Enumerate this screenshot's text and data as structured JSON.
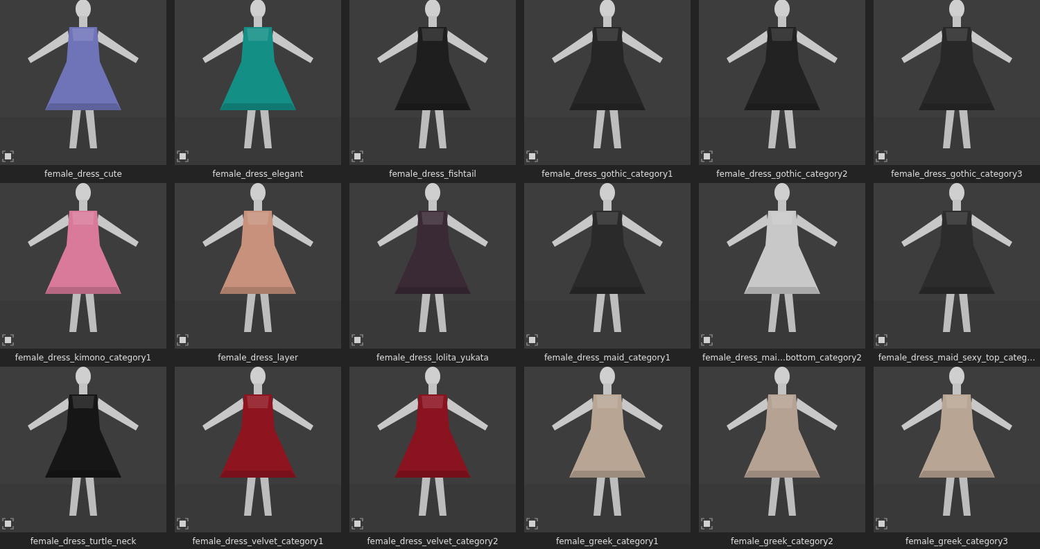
{
  "assets": [
    {
      "label": "female_dress_cute",
      "kind": "picture"
    },
    {
      "label": "female_dress_elegant",
      "kind": "picture"
    },
    {
      "label": "female_dress_fishtail",
      "kind": "picture"
    },
    {
      "label": "female_dress_gothic_category1",
      "kind": "picture"
    },
    {
      "label": "female_dress_gothic_category2",
      "kind": "picture"
    },
    {
      "label": "female_dress_gothic_category3",
      "kind": "picture"
    },
    {
      "label": "female_dress_kimono_category1",
      "kind": "picture"
    },
    {
      "label": "female_dress_layer",
      "kind": "picture"
    },
    {
      "label": "female_dress_lolita_yukata",
      "kind": "picture"
    },
    {
      "label": "female_dress_maid_category1",
      "kind": "picture"
    },
    {
      "label": "female_dress_mai…bottom_category2",
      "kind": "picture"
    },
    {
      "label": "female_dress_maid_sexy_top_categ…",
      "kind": "picture"
    },
    {
      "label": "female_dress_turtle_neck",
      "kind": "picture"
    },
    {
      "label": "female_dress_velvet_category1",
      "kind": "picture"
    },
    {
      "label": "female_dress_velvet_category2",
      "kind": "picture"
    },
    {
      "label": "female_greek_category1",
      "kind": "picture"
    },
    {
      "label": "female_greek_category2",
      "kind": "picture"
    },
    {
      "label": "female_greek_category3",
      "kind": "picture"
    }
  ]
}
